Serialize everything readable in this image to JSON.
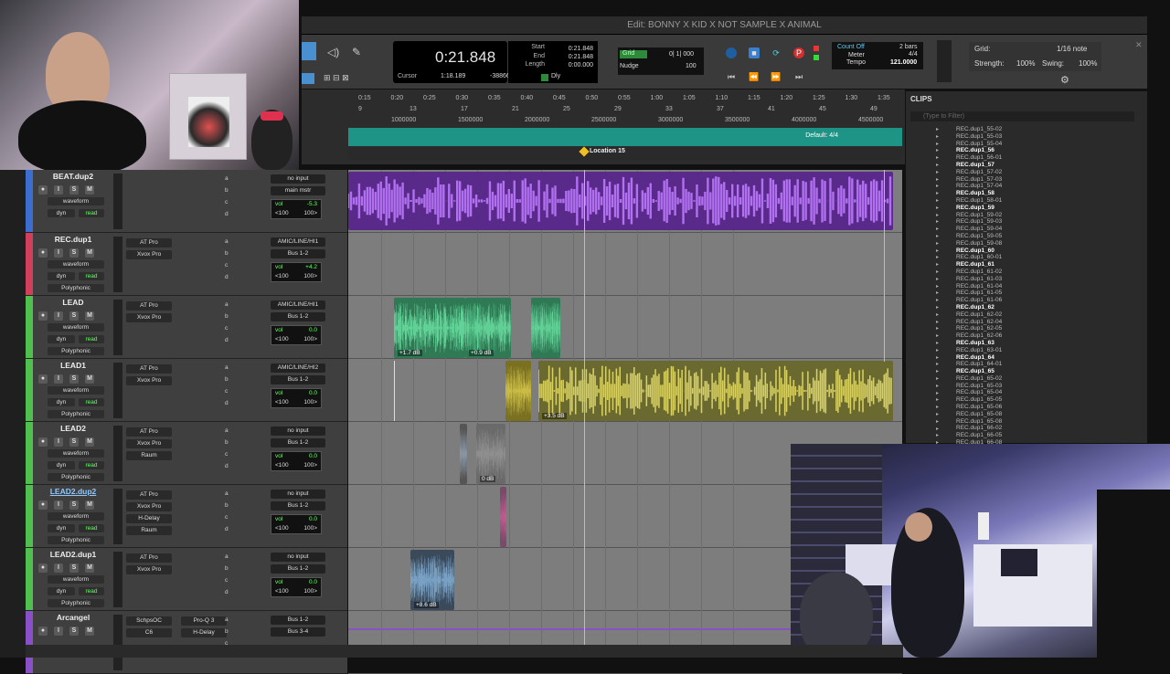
{
  "window": {
    "title": "Edit: BONNY X KID X NOT SAMPLE X ANIMAL"
  },
  "counter": {
    "main": "0:21.848",
    "cursor_label": "Cursor",
    "cursor_value": "1:18.189",
    "samples_value": "-3886608"
  },
  "selection": {
    "start_label": "Start",
    "end_label": "End",
    "length_label": "Length",
    "start": "0:21.848",
    "end": "0:21.848",
    "length": "0:00.000"
  },
  "grid_nudge": {
    "grid_label": "Grid",
    "grid_value": "0| 1| 000",
    "nudge_label": "Nudge",
    "nudge_value": "100",
    "dly_label": "Dly"
  },
  "countoff": {
    "count_off": "Count Off",
    "meter_label": "Meter",
    "tempo_label": "Tempo",
    "bars": "2 bars",
    "meter": "4/4",
    "tempo": "121.0000"
  },
  "grid_panel": {
    "grid_label": "Grid:",
    "grid_value": "1/16 note",
    "strength_label": "Strength:",
    "strength": "100%",
    "swing_label": "Swing:",
    "swing": "100%"
  },
  "ruler": {
    "time": [
      "0:15",
      "0:20",
      "0:25",
      "0:30",
      "0:35",
      "0:40",
      "0:45",
      "0:50",
      "0:55",
      "1:00",
      "1:05",
      "1:10",
      "1:15",
      "1:20",
      "1:25",
      "1:30",
      "1:35"
    ],
    "bars": [
      "9",
      "13",
      "17",
      "21",
      "25",
      "29",
      "33",
      "37",
      "41",
      "45",
      "49"
    ],
    "samples": [
      "1000000",
      "1500000",
      "2000000",
      "2500000",
      "3000000",
      "3500000",
      "4000000",
      "4500000"
    ],
    "tempo_marker": "Default: 4/4",
    "location": "Location 15"
  },
  "tracks": [
    {
      "name": "BEAT.dup2",
      "color": "#3b6ecf",
      "inserts": [
        "",
        ""
      ],
      "io_in": "no input",
      "io_out": "main mstr",
      "vol": "-5.3",
      "pan_l": "<100",
      "pan_r": "100>",
      "view": "waveform",
      "dyn": "dyn",
      "mode": "read",
      "extra": "",
      "selected": false
    },
    {
      "name": "REC.dup1",
      "color": "#d0405a",
      "inserts": [
        "AT Pro",
        "Xvox Pro"
      ],
      "io_in": "AMIC/LINE/HI1",
      "io_out": "Bus 1-2",
      "vol": "+4.2",
      "pan_l": "<100",
      "pan_r": "100>",
      "view": "waveform",
      "dyn": "dyn",
      "mode": "read",
      "extra": "Polyphonic",
      "selected": false
    },
    {
      "name": "LEAD",
      "color": "#4fc050",
      "inserts": [
        "AT Pro",
        "Xvox Pro"
      ],
      "io_in": "AMIC/LINE/HI1",
      "io_out": "Bus 1-2",
      "vol": "0.0",
      "pan_l": "<100",
      "pan_r": "100>",
      "view": "waveform",
      "dyn": "dyn",
      "mode": "read",
      "extra": "Polyphonic",
      "selected": false
    },
    {
      "name": "LEAD1",
      "color": "#4fc050",
      "inserts": [
        "AT Pro",
        "Xvox Pro"
      ],
      "io_in": "AMIC/LINE/HI2",
      "io_out": "Bus 1-2",
      "vol": "0.0",
      "pan_l": "<100",
      "pan_r": "100>",
      "view": "waveform",
      "dyn": "dyn",
      "mode": "read",
      "extra": "Polyphonic",
      "selected": false
    },
    {
      "name": "LEAD2",
      "color": "#4fc050",
      "inserts": [
        "AT Pro",
        "Xvox Pro",
        "Raum"
      ],
      "io_in": "no input",
      "io_out": "Bus 1-2",
      "vol": "0.0",
      "pan_l": "<100",
      "pan_r": "100>",
      "view": "waveform",
      "dyn": "dyn",
      "mode": "read",
      "extra": "Polyphonic",
      "selected": false
    },
    {
      "name": "LEAD2.dup2",
      "color": "#4fc050",
      "inserts": [
        "AT Pro",
        "Xvox Pro",
        "H-Delay",
        "Raum"
      ],
      "io_in": "no input",
      "io_out": "Bus 1-2",
      "vol": "0.0",
      "pan_l": "<100",
      "pan_r": "100>",
      "view": "waveform",
      "dyn": "dyn",
      "mode": "read",
      "extra": "Polyphonic",
      "selected": true
    },
    {
      "name": "LEAD2.dup1",
      "color": "#4fc050",
      "inserts": [
        "AT Pro",
        "Xvox Pro"
      ],
      "io_in": "no input",
      "io_out": "Bus 1-2",
      "vol": "0.0",
      "pan_l": "<100",
      "pan_r": "100>",
      "view": "waveform",
      "dyn": "dyn",
      "mode": "read",
      "extra": "Polyphonic",
      "selected": false
    },
    {
      "name": "Arcangel",
      "color": "#8a50c8",
      "inserts": [
        "SchpsOC",
        "C6"
      ],
      "io_in": "Bus 1-2",
      "io_out": "Bus 3-4",
      "vol": "",
      "pan_l": "",
      "pan_r": "",
      "view": "",
      "dyn": "",
      "mode": "",
      "extra": "",
      "selected": false,
      "inserts2": [
        "Pro-Q 3",
        "H-Delay"
      ]
    }
  ],
  "clip_labels": {
    "lead_a": "+1.7 dB",
    "lead_b": "+0.9 dB",
    "lead1": "+3.5 dB",
    "lead2": "0 dB",
    "lead2dup1": "+8.6 dB"
  },
  "clips_panel": {
    "title": "CLIPS",
    "filter_placeholder": "(Type to Filter)",
    "items": [
      {
        "t": "REC.dup1_55-02",
        "b": false
      },
      {
        "t": "REC.dup1_55-03",
        "b": false
      },
      {
        "t": "REC.dup1_55-04",
        "b": false
      },
      {
        "t": "REC.dup1_56",
        "b": true
      },
      {
        "t": "REC.dup1_56-01",
        "b": false
      },
      {
        "t": "REC.dup1_57",
        "b": true
      },
      {
        "t": "REC.dup1_57-02",
        "b": false
      },
      {
        "t": "REC.dup1_57-03",
        "b": false
      },
      {
        "t": "REC.dup1_57-04",
        "b": false
      },
      {
        "t": "REC.dup1_58",
        "b": true
      },
      {
        "t": "REC.dup1_58-01",
        "b": false
      },
      {
        "t": "REC.dup1_59",
        "b": true
      },
      {
        "t": "REC.dup1_59-02",
        "b": false
      },
      {
        "t": "REC.dup1_59-03",
        "b": false
      },
      {
        "t": "REC.dup1_59-04",
        "b": false
      },
      {
        "t": "REC.dup1_59-05",
        "b": false
      },
      {
        "t": "REC.dup1_59-08",
        "b": false
      },
      {
        "t": "REC.dup1_60",
        "b": true
      },
      {
        "t": "REC.dup1_60-01",
        "b": false
      },
      {
        "t": "REC.dup1_61",
        "b": true
      },
      {
        "t": "REC.dup1_61-02",
        "b": false
      },
      {
        "t": "REC.dup1_61-03",
        "b": false
      },
      {
        "t": "REC.dup1_61-04",
        "b": false
      },
      {
        "t": "REC.dup1_61-05",
        "b": false
      },
      {
        "t": "REC.dup1_61-06",
        "b": false
      },
      {
        "t": "REC.dup1_62",
        "b": true
      },
      {
        "t": "REC.dup1_62-02",
        "b": false
      },
      {
        "t": "REC.dup1_62-04",
        "b": false
      },
      {
        "t": "REC.dup1_62-05",
        "b": false
      },
      {
        "t": "REC.dup1_62-06",
        "b": false
      },
      {
        "t": "REC.dup1_63",
        "b": true
      },
      {
        "t": "REC.dup1_63-01",
        "b": false
      },
      {
        "t": "REC.dup1_64",
        "b": true
      },
      {
        "t": "REC.dup1_64-01",
        "b": false
      },
      {
        "t": "REC.dup1_65",
        "b": true
      },
      {
        "t": "REC.dup1_65-02",
        "b": false
      },
      {
        "t": "REC.dup1_65-03",
        "b": false
      },
      {
        "t": "REC.dup1_65-04",
        "b": false
      },
      {
        "t": "REC.dup1_65-05",
        "b": false
      },
      {
        "t": "REC.dup1_65-06",
        "b": false
      },
      {
        "t": "REC.dup1_65-08",
        "b": false
      },
      {
        "t": "REC.dup1_65-08",
        "b": false
      },
      {
        "t": "REC.dup1_66-02",
        "b": false
      },
      {
        "t": "REC.dup1_66-05",
        "b": false
      },
      {
        "t": "REC.dup1_66-08",
        "b": false
      }
    ]
  },
  "colors": {
    "beat": "#8a3ec8",
    "lead": "#3aa870",
    "lead1": "#a8a030",
    "teal": "#1e9486",
    "playhead": "#e0c050"
  },
  "webcam_top": {
    "poster_text": ""
  },
  "webcam_bottom": {
    "sign_text": ""
  }
}
